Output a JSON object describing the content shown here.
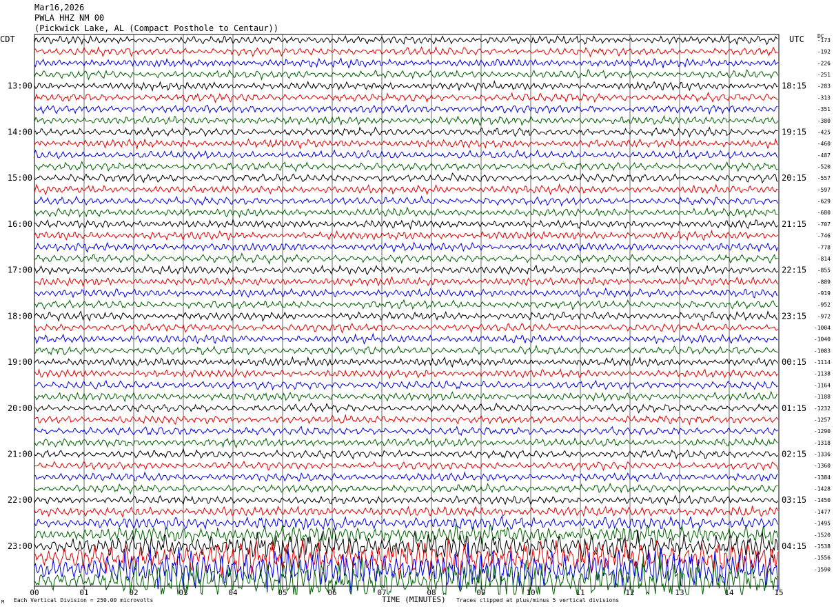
{
  "header": {
    "date": "Mar16,2026",
    "station": "PWLA HHZ NM 00",
    "location": "(Pickwick Lake, AL (Compact Posthole to Centaur))"
  },
  "labels": {
    "left_tz": "CDT",
    "right_tz": "UTC",
    "dc": "DC",
    "xlabel": "TIME (MINUTES)",
    "scale_note": "Each Vertical Division = 250.00 microvolts",
    "clip_note": "Traces clipped at plus/minus 5 vertical divisions",
    "corner_mark": "M"
  },
  "colors": {
    "trace_cycle": [
      "#000000",
      "#e00000",
      "#0000e0",
      "#006000"
    ],
    "grid": "#000000"
  },
  "chart_data": {
    "type": "line",
    "subtype": "helicorder",
    "x_range": [
      0,
      15
    ],
    "x_ticks": [
      "00",
      "01",
      "02",
      "03",
      "04",
      "05",
      "06",
      "07",
      "08",
      "09",
      "10",
      "11",
      "12",
      "13",
      "14",
      "15"
    ],
    "trace_count": 48,
    "trace_minutes": 15,
    "left_hour_labels": [
      "13:00",
      "14:00",
      "15:00",
      "16:00",
      "17:00",
      "18:00",
      "19:00",
      "20:00",
      "21:00",
      "22:00",
      "23:00"
    ],
    "right_hour_labels": [
      "18:15",
      "19:15",
      "20:15",
      "21:15",
      "22:15",
      "23:15",
      "00:15",
      "01:15",
      "02:15",
      "03:15",
      "04:15"
    ],
    "hour_label_first_trace": 4,
    "hour_label_every": 4,
    "dc_offsets": [
      "-173",
      "-192",
      "-226",
      "-251",
      "-283",
      "-313",
      "-351",
      "-380",
      "-425",
      "-460",
      "-487",
      "-520",
      "-557",
      "-597",
      "-629",
      "-680",
      "-707",
      "-746",
      "-778",
      "-814",
      "-855",
      "-889",
      "-919",
      "-952",
      "-972",
      "-1004",
      "-1040",
      "-1083",
      "-1114",
      "-1138",
      "-1164",
      "-1188",
      "-1232",
      "-1257",
      "-1290",
      "-1318",
      "-1336",
      "-1360",
      "-1384",
      "-1428",
      "-1450",
      "-1477",
      "-1495",
      "-1520",
      "-1538",
      "-1556",
      "-1590"
    ],
    "amplitude_profile": [
      1,
      1,
      1,
      1,
      1,
      1,
      1,
      1,
      1,
      1,
      1,
      1,
      1,
      1,
      1,
      1,
      1,
      1,
      1,
      1,
      1,
      1,
      1,
      1,
      1,
      1,
      1,
      1,
      1,
      1,
      1,
      1,
      1,
      1,
      1,
      1,
      1,
      1,
      1,
      1,
      1,
      1.2,
      1.6,
      2.2,
      3.0,
      4.0,
      5.0,
      5.0
    ],
    "clip_divisions": 5
  }
}
